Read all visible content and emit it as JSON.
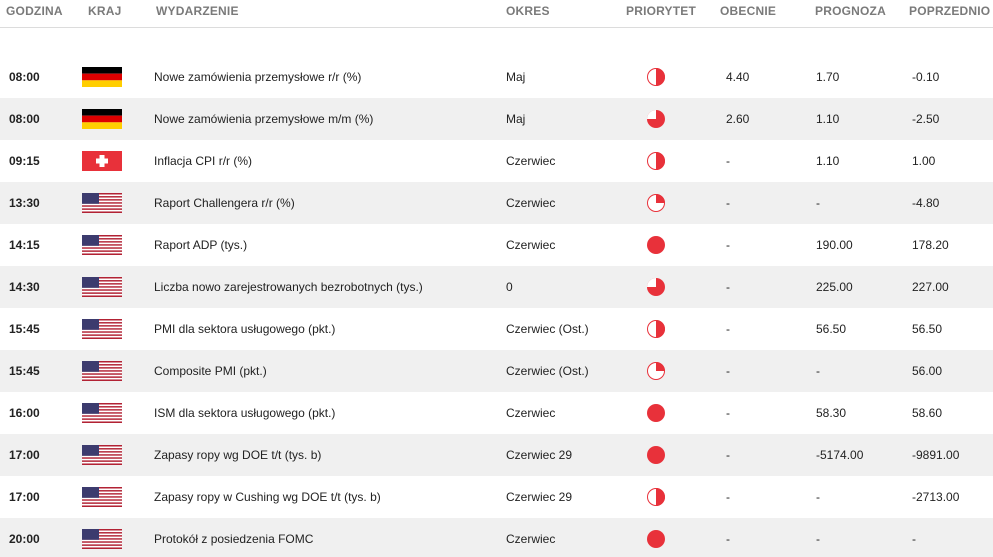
{
  "columns": {
    "time": "GODZINA",
    "country": "KRAJ",
    "event": "WYDARZENIE",
    "period": "OKRES",
    "priority": "PRIORYTET",
    "actual": "OBECNIE",
    "forecast": "PROGNOZA",
    "previous": "POPRZEDNIO"
  },
  "colors": {
    "priority": "#e8313a",
    "header_text": "#7a7a7a",
    "row_alt": "#f0f0f0"
  },
  "rows": [
    {
      "time": "08:00",
      "country": "germany-flag",
      "event": "Nowe zamówienia przemysłowe r/r (%)",
      "period": "Maj",
      "priority": "medium",
      "actual": "4.40",
      "forecast": "1.70",
      "previous": "-0.10"
    },
    {
      "time": "08:00",
      "country": "germany-flag",
      "event": "Nowe zamówienia przemysłowe m/m (%)",
      "period": "Maj",
      "priority": "high-medium",
      "actual": "2.60",
      "forecast": "1.10",
      "previous": "-2.50"
    },
    {
      "time": "09:15",
      "country": "switzerland-flag",
      "event": "Inflacja CPI r/r (%)",
      "period": "Czerwiec",
      "priority": "medium",
      "actual": "-",
      "forecast": "1.10",
      "previous": "1.00"
    },
    {
      "time": "13:30",
      "country": "usa-flag",
      "event": "Raport Challengera r/r (%)",
      "period": "Czerwiec",
      "priority": "low",
      "actual": "-",
      "forecast": "-",
      "previous": "-4.80"
    },
    {
      "time": "14:15",
      "country": "usa-flag",
      "event": "Raport ADP (tys.)",
      "period": "Czerwiec",
      "priority": "high",
      "actual": "-",
      "forecast": "190.00",
      "previous": "178.20"
    },
    {
      "time": "14:30",
      "country": "usa-flag",
      "event": "Liczba nowo zarejestrowanych bezrobotnych (tys.)",
      "period": "0",
      "priority": "high-medium",
      "actual": "-",
      "forecast": "225.00",
      "previous": "227.00"
    },
    {
      "time": "15:45",
      "country": "usa-flag",
      "event": "PMI dla sektora usługowego (pkt.)",
      "period": "Czerwiec (Ost.)",
      "priority": "medium",
      "actual": "-",
      "forecast": "56.50",
      "previous": "56.50"
    },
    {
      "time": "15:45",
      "country": "usa-flag",
      "event": "Composite PMI (pkt.)",
      "period": "Czerwiec (Ost.)",
      "priority": "low",
      "actual": "-",
      "forecast": "-",
      "previous": "56.00"
    },
    {
      "time": "16:00",
      "country": "usa-flag",
      "event": "ISM dla sektora usługowego (pkt.)",
      "period": "Czerwiec",
      "priority": "high",
      "actual": "-",
      "forecast": "58.30",
      "previous": "58.60"
    },
    {
      "time": "17:00",
      "country": "usa-flag",
      "event": "Zapasy ropy wg DOE t/t (tys. b)",
      "period": "Czerwiec 29",
      "priority": "high",
      "actual": "-",
      "forecast": "-5174.00",
      "previous": "-9891.00"
    },
    {
      "time": "17:00",
      "country": "usa-flag",
      "event": "Zapasy ropy w Cushing wg DOE t/t (tys. b)",
      "period": "Czerwiec 29",
      "priority": "medium",
      "actual": "-",
      "forecast": "-",
      "previous": "-2713.00"
    },
    {
      "time": "20:00",
      "country": "usa-flag",
      "event": "Protokół z posiedzenia FOMC",
      "period": "Czerwiec",
      "priority": "high",
      "actual": "-",
      "forecast": "-",
      "previous": "-"
    }
  ]
}
